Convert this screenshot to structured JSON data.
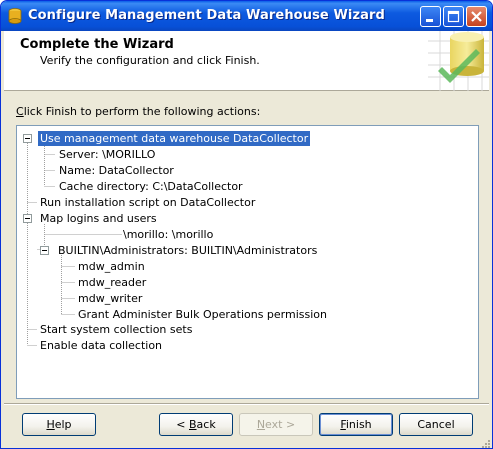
{
  "window": {
    "title": "Configure Management Data Warehouse Wizard"
  },
  "header": {
    "title": "Complete the Wizard",
    "subtitle": "Verify the configuration and click Finish."
  },
  "instructions": {
    "prefix": "C",
    "rest": "lick Finish to perform the following actions:"
  },
  "tree": {
    "use_mdw": "Use management data warehouse DataCollector",
    "server": "Server:                      \\MORILLO",
    "name": "Name: DataCollector",
    "cache_dir": "Cache directory: C:\\DataCollector",
    "run_script": "Run installation script on DataCollector",
    "map_logins": "Map logins and users",
    "morillo_mapping": "\\morillo:                      \\morillo",
    "builtin_admins": "BUILTIN\\Administrators: BUILTIN\\Administrators",
    "mdw_admin": "mdw_admin",
    "mdw_reader": "mdw_reader",
    "mdw_writer": "mdw_writer",
    "grant_bulk": "Grant Administer Bulk Operations permission",
    "start_sets": "Start system collection sets",
    "enable_collection": "Enable data collection"
  },
  "buttons": {
    "help_mn": "H",
    "help_rest": "elp",
    "back_prefix": "< ",
    "back_mn": "B",
    "back_rest": "ack",
    "next_mn": "N",
    "next_rest": "ext >",
    "finish_mn": "F",
    "finish_rest": "inish",
    "cancel": "Cancel"
  },
  "colors": {
    "selection": "#316ac5",
    "titlebar": "#0a5ee8",
    "dialog_bg": "#ece9d8"
  },
  "icons": {
    "app": "sql-server-icon",
    "minimize": "minimize-icon",
    "maximize": "maximize-icon",
    "close": "close-icon",
    "wizard_graphic": "database-check-graphic"
  }
}
